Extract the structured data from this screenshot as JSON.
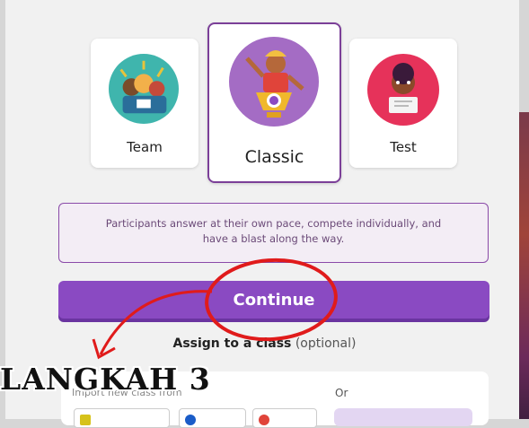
{
  "modes": {
    "team": {
      "label": "Team"
    },
    "classic": {
      "label": "Classic",
      "selected": true
    },
    "test": {
      "label": "Test"
    }
  },
  "description": "Participants answer at their own pace, compete individually, and have a blast along the way.",
  "continue_label": "Continue",
  "assign": {
    "bold": "Assign to a class",
    "optional": "(optional)"
  },
  "import_text": "Import new class from",
  "or_text": "Or",
  "annotation": {
    "step_text": "LANGKAH 3"
  },
  "colors": {
    "accent": "#8a4ac2",
    "border": "#7b3f98",
    "annotation": "#e01b1b"
  }
}
